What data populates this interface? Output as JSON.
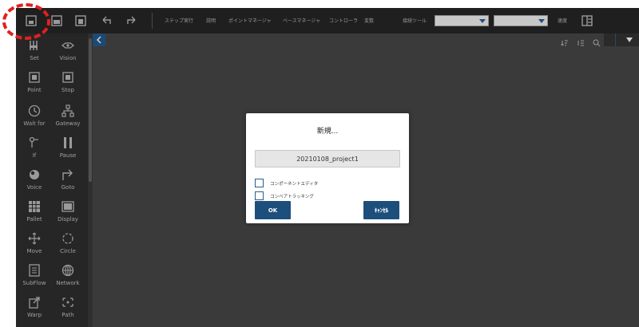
{
  "toolbar": {
    "menu_items": [
      "ステップ実行",
      "説明",
      "ポイントマネージャ",
      "ベースマネージャ",
      "コントローラ",
      "変数"
    ],
    "robot_label": "接続ツール",
    "robot_select_value": "",
    "speed_select_value": "",
    "speed_label": "速度"
  },
  "palette": {
    "items": [
      {
        "label": "Set",
        "icon": "set-icon"
      },
      {
        "label": "Vision",
        "icon": "vision-icon"
      },
      {
        "label": "Point",
        "icon": "point-icon"
      },
      {
        "label": "Stop",
        "icon": "stop-icon"
      },
      {
        "label": "Wait for",
        "icon": "wait-icon"
      },
      {
        "label": "Gateway",
        "icon": "gateway-icon"
      },
      {
        "label": "If",
        "icon": "if-icon"
      },
      {
        "label": "Pause",
        "icon": "pause-icon"
      },
      {
        "label": "Voice",
        "icon": "voice-icon"
      },
      {
        "label": "Goto",
        "icon": "goto-icon"
      },
      {
        "label": "Pallet",
        "icon": "pallet-icon"
      },
      {
        "label": "Display",
        "icon": "display-icon"
      },
      {
        "label": "Move",
        "icon": "move-icon"
      },
      {
        "label": "Circle",
        "icon": "circle-icon"
      },
      {
        "label": "SubFlow",
        "icon": "subflow-icon"
      },
      {
        "label": "Network",
        "icon": "network-icon"
      },
      {
        "label": "Warp",
        "icon": "warp-icon"
      },
      {
        "label": "Path",
        "icon": "path-icon"
      }
    ]
  },
  "dialog": {
    "title": "新規...",
    "project_name": "20210108_project1",
    "checkbox_1": "コンポーネントエディタ",
    "checkbox_2": "コンベアトラッキング",
    "ok_label": "OK",
    "cancel_label": "ｷｬﾝｾﾙ"
  },
  "colors": {
    "toolbar_bg": "#1f1f1f",
    "palette_bg": "#262626",
    "canvas_bg": "#3a3a3a",
    "accent": "#1d4f7c",
    "highlight": "#e02020"
  }
}
